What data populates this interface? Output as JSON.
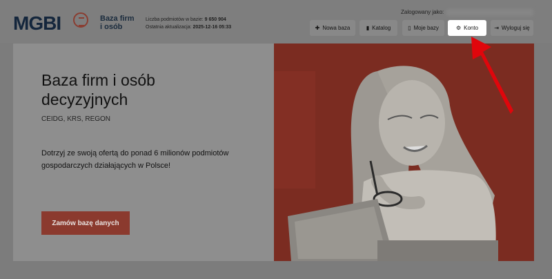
{
  "header": {
    "logo": "MGBI",
    "brand_line1": "Baza firm",
    "brand_line2": "i osób",
    "stats_line1_label": "Liczba podmiotów w bazie:",
    "stats_line1_value": "9 650 904",
    "stats_line2_label": "Ostatnia aktualizacja:",
    "stats_line2_value": "2025-12-16 05:33",
    "login_label": "Zalogowany jako:"
  },
  "toolbar": {
    "new_db": "Nowa baza",
    "catalog": "Katalog",
    "my_dbs": "Moje bazy",
    "account": "Konto",
    "logout": "Wyloguj się"
  },
  "hero": {
    "title": "Baza firm i osób decyzyjnych",
    "subtitle": "CEIDG, KRS, REGON",
    "text": "Dotrzyj ze swoją ofertą do ponad 6 milionów podmiotów gospodarczych działających w Polsce!",
    "order_button": "Zamów bazę danych"
  },
  "icons": {
    "new_db": "plus-icon",
    "catalog": "book-icon",
    "my_dbs": "document-icon",
    "account": "gear-icon",
    "logout": "logout-icon"
  },
  "colors": {
    "overlay": "#7c7c7c",
    "brand_navy": "#14263c",
    "accent_red": "#8b3a2e",
    "annotation_arrow": "#e0060c",
    "highlight": "#ffffff"
  }
}
